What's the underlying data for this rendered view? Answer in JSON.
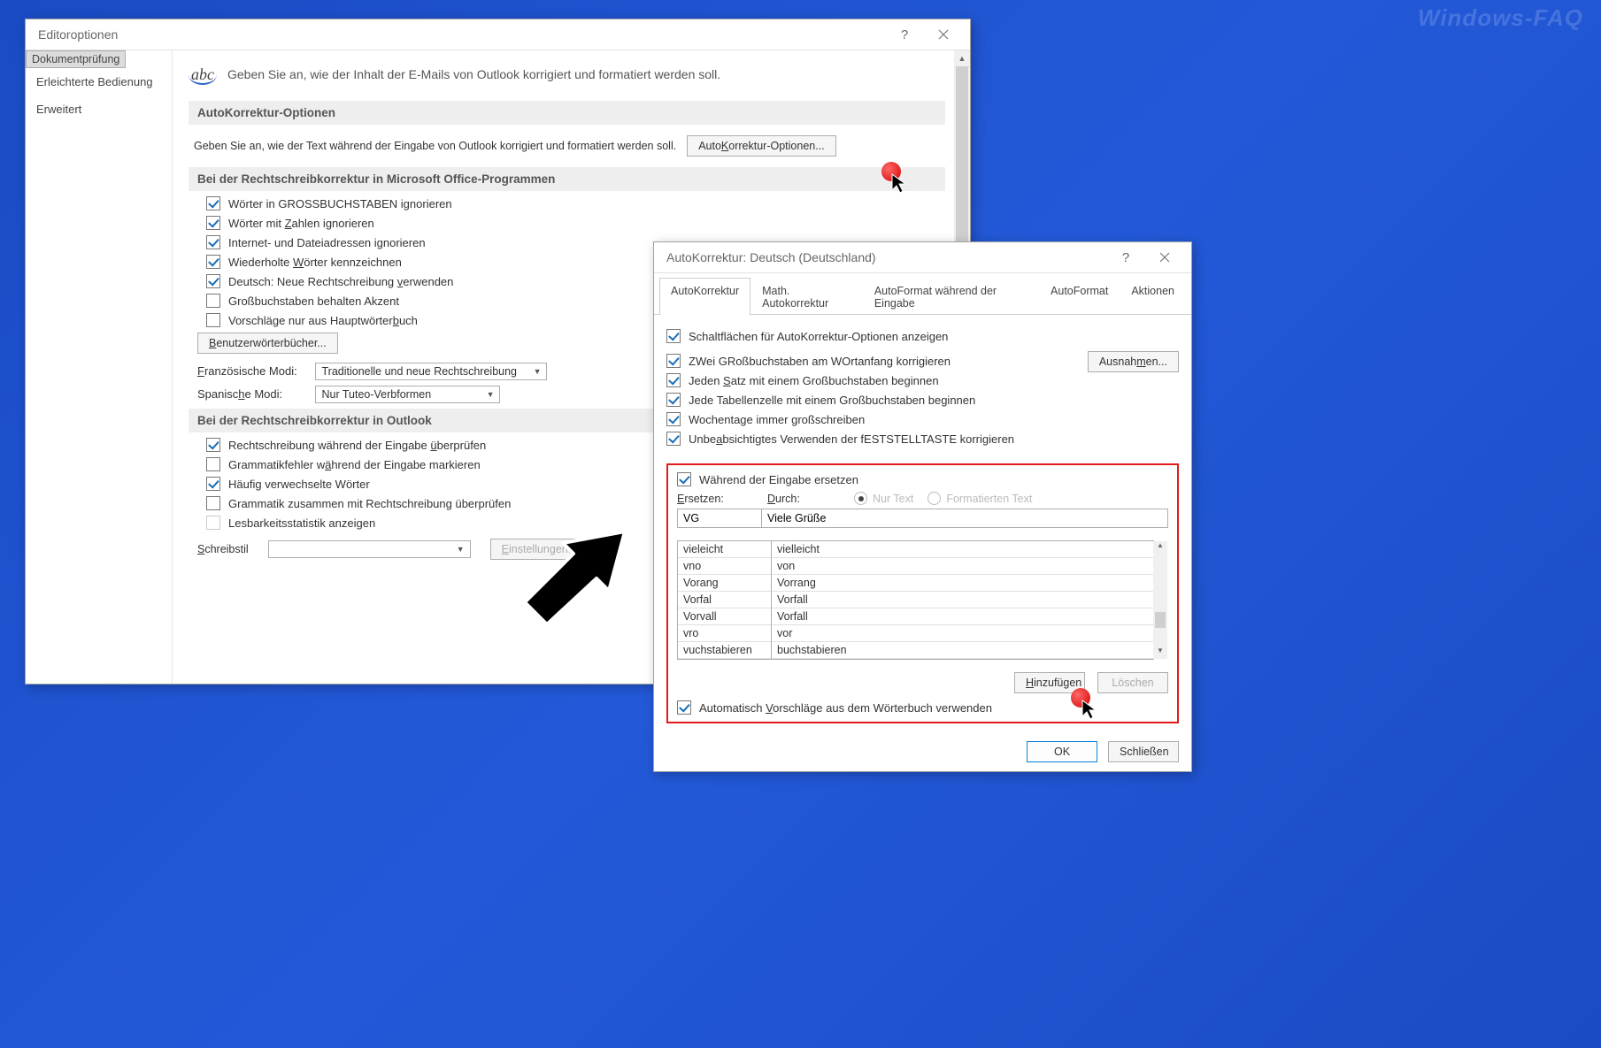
{
  "watermark": "Windows-FAQ",
  "editor": {
    "title": "Editoroptionen",
    "sidebar": {
      "items": [
        "Dokumentprüfung",
        "Erleichterte Bedienung",
        "Erweitert"
      ],
      "selected": 0
    },
    "intro": "Geben Sie an, wie der Inhalt der E-Mails von Outlook korrigiert und formatiert werden soll.",
    "group_autocorr": {
      "head": "AutoKorrektur-Optionen",
      "desc": "Geben Sie an, wie der Text während der Eingabe von Outlook korrigiert und formatiert werden soll.",
      "btn": "AutoKorrektur-Optionen..."
    },
    "group_office": {
      "head": "Bei der Rechtschreibkorrektur in Microsoft Office-Programmen",
      "opts": [
        {
          "label": "Wörter in GROSSBUCHSTABEN ignorieren",
          "checked": true
        },
        {
          "label": "Wörter mit Zahlen ignorieren",
          "checked": true
        },
        {
          "label": "Internet- und Dateiadressen ignorieren",
          "checked": true
        },
        {
          "label": "Wiederholte Wörter kennzeichnen",
          "checked": true
        },
        {
          "label": "Deutsch: Neue Rechtschreibung verwenden",
          "checked": true
        },
        {
          "label": "Großbuchstaben behalten Akzent",
          "checked": false
        },
        {
          "label": "Vorschläge nur aus Hauptwörterbuch",
          "checked": false
        }
      ],
      "dict_btn": "Benutzerwörterbücher...",
      "fr_label": "Französische Modi:",
      "fr_val": "Traditionelle und neue Rechtschreibung",
      "es_label": "Spanische Modi:",
      "es_val": "Nur Tuteo-Verbformen"
    },
    "group_outlook": {
      "head": "Bei der Rechtschreibkorrektur in Outlook",
      "opts": [
        {
          "label": "Rechtschreibung während der Eingabe überprüfen",
          "checked": true
        },
        {
          "label": "Grammatikfehler während der Eingabe markieren",
          "checked": false
        },
        {
          "label": "Häufig verwechselte Wörter",
          "checked": true
        },
        {
          "label": "Grammatik zusammen mit Rechtschreibung überprüfen",
          "checked": false
        },
        {
          "label": "Lesbarkeitsstatistik anzeigen",
          "checked": false,
          "disabled": true
        }
      ],
      "style_label": "Schreibstil",
      "style_btn": "Einstellungen..."
    }
  },
  "ac": {
    "title": "AutoKorrektur: Deutsch (Deutschland)",
    "tabs": [
      "AutoKorrektur",
      "Math. Autokorrektur",
      "AutoFormat während der Eingabe",
      "AutoFormat",
      "Aktionen"
    ],
    "active_tab": 0,
    "top_opts": [
      {
        "label": "Schaltflächen für AutoKorrektur-Optionen anzeigen",
        "checked": true
      },
      {
        "label": "ZWei GRoßbuchstaben am WOrtanfang korrigieren",
        "checked": true
      },
      {
        "label": "Jeden Satz mit einem Großbuchstaben beginnen",
        "checked": true
      },
      {
        "label": "Jede Tabellenzelle mit einem Großbuchstaben beginnen",
        "checked": true
      },
      {
        "label": "Wochentage immer großschreiben",
        "checked": true
      },
      {
        "label": "Unbeabsichtigtes Verwenden der fESTSTELLTASTE korrigieren",
        "checked": true
      }
    ],
    "exceptions_btn": "Ausnahmen...",
    "replace_chk": {
      "label": "Während der Eingabe ersetzen",
      "checked": true
    },
    "replace_label": "Ersetzen:",
    "with_label": "Durch:",
    "radio_plain": "Nur Text",
    "radio_fmt": "Formatierten Text",
    "replace_val": "VG",
    "with_val": "Viele Grüße",
    "list": [
      {
        "a": "vieleicht",
        "b": "vielleicht"
      },
      {
        "a": "vno",
        "b": "von"
      },
      {
        "a": "Vorang",
        "b": "Vorrang"
      },
      {
        "a": "Vorfal",
        "b": "Vorfall"
      },
      {
        "a": "Vorvall",
        "b": "Vorfall"
      },
      {
        "a": "vro",
        "b": "vor"
      },
      {
        "a": "vuchstabieren",
        "b": "buchstabieren"
      }
    ],
    "add_btn": "Hinzufügen",
    "del_btn": "Löschen",
    "auto_suggest": {
      "label": "Automatisch Vorschläge aus dem Wörterbuch verwenden",
      "checked": true
    },
    "ok": "OK",
    "close": "Schließen"
  }
}
